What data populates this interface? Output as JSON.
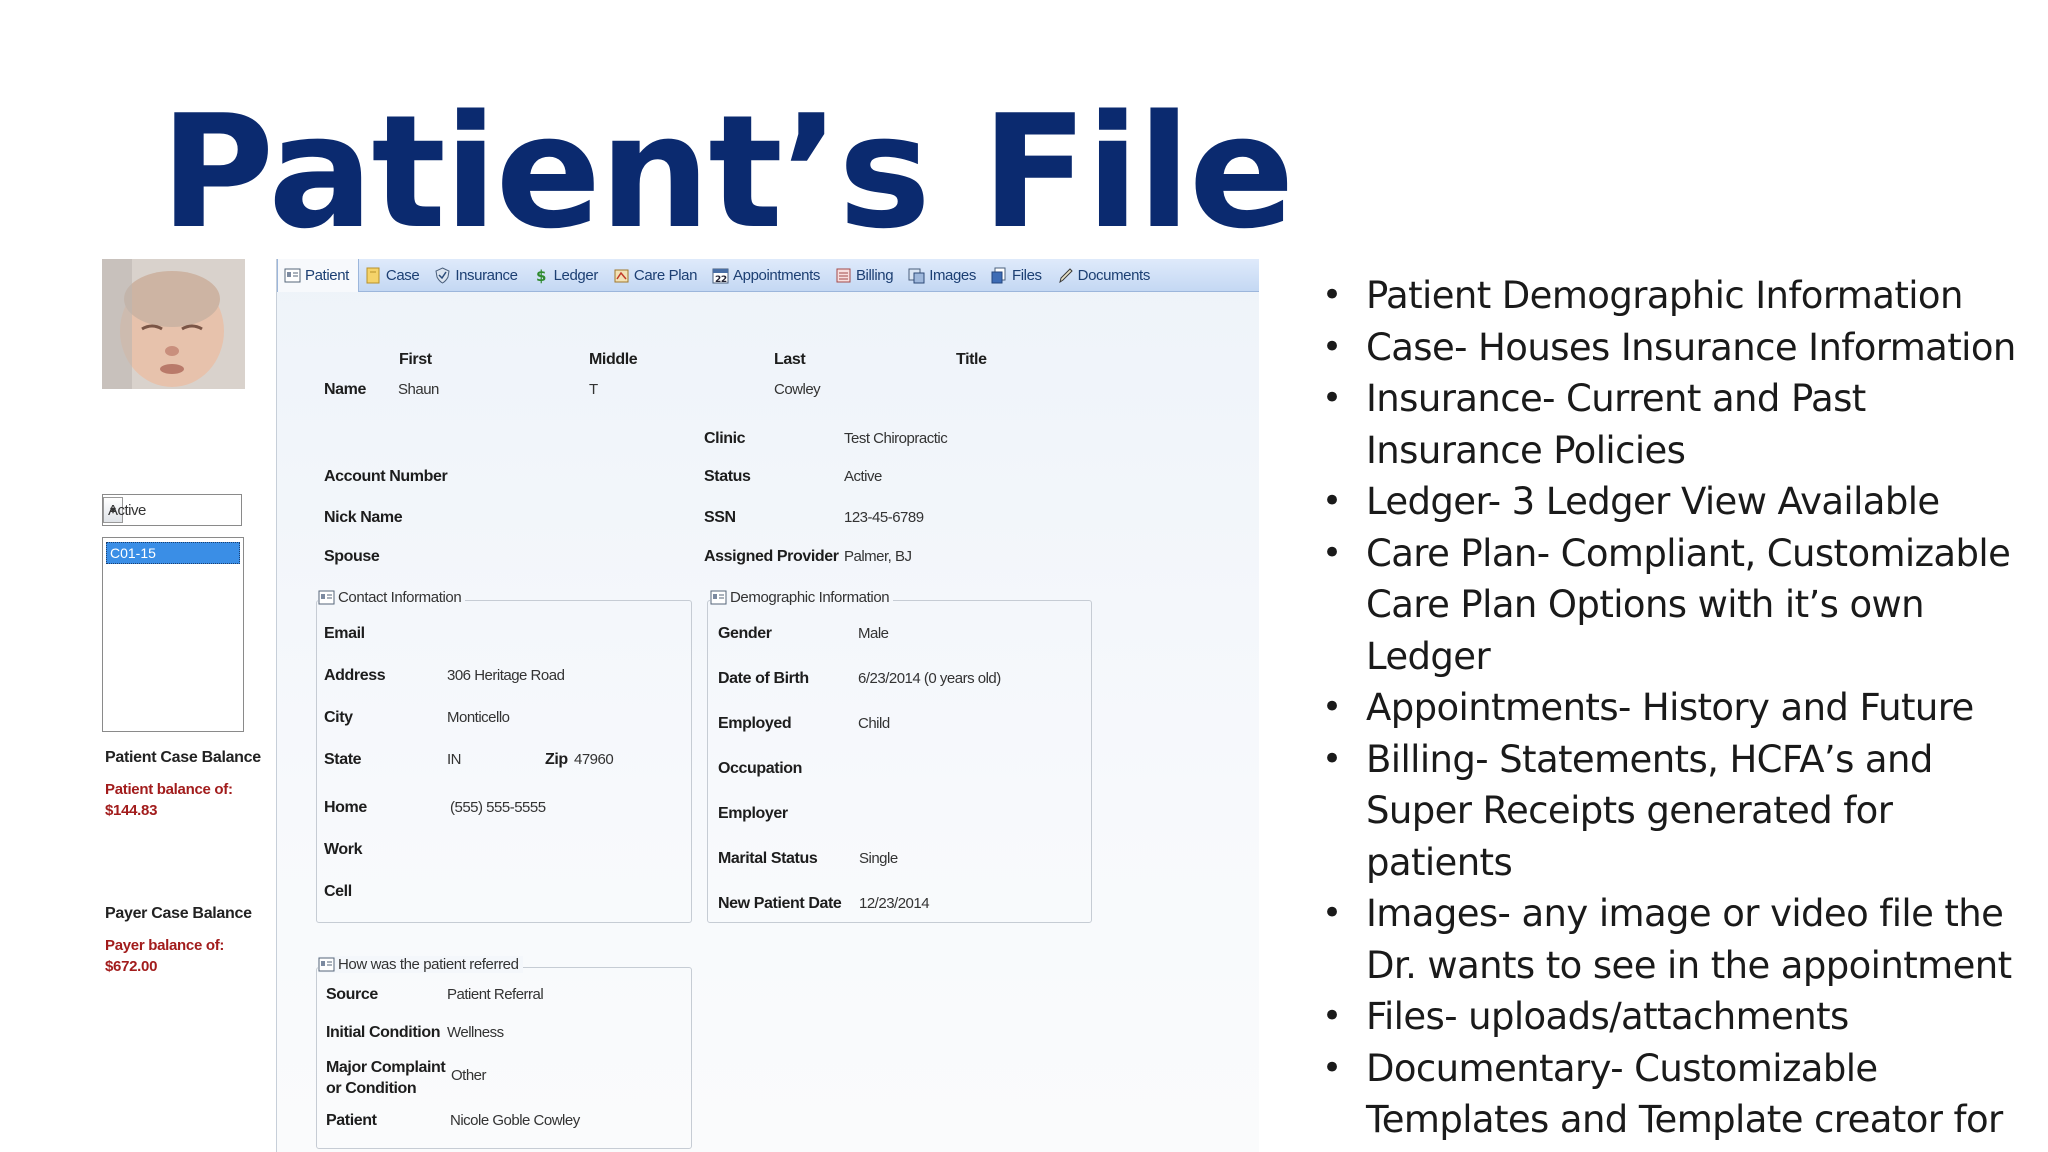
{
  "slide": {
    "title": "Patient’s File"
  },
  "sidebar": {
    "status_value": "Active",
    "cases": [
      "C01-15"
    ],
    "patient_case_balance_label": "Patient Case Balance",
    "patient_balance_line1": "Patient balance of:",
    "patient_balance_amount": "$144.83",
    "payer_case_balance_label": "Payer Case Balance",
    "payer_balance_line1": "Payer balance of:",
    "payer_balance_amount": "$672.00"
  },
  "tabs": [
    {
      "label": "Patient",
      "icon": "patient-card-icon"
    },
    {
      "label": "Case",
      "icon": "folder-icon"
    },
    {
      "label": "Insurance",
      "icon": "shield-icon"
    },
    {
      "label": "Ledger",
      "icon": "dollar-icon"
    },
    {
      "label": "Care Plan",
      "icon": "care-plan-icon"
    },
    {
      "label": "Appointments",
      "icon": "calendar-icon"
    },
    {
      "label": "Billing",
      "icon": "billing-icon"
    },
    {
      "label": "Images",
      "icon": "images-icon"
    },
    {
      "label": "Files",
      "icon": "files-icon"
    },
    {
      "label": "Documents",
      "icon": "pen-icon"
    }
  ],
  "name_section": {
    "first_header": "First",
    "middle_header": "Middle",
    "last_header": "Last",
    "title_header": "Title",
    "name_label": "Name",
    "first": "Shaun",
    "middle": "T",
    "last": "Cowley"
  },
  "account": {
    "account_number_label": "Account Number",
    "nick_name_label": "Nick Name",
    "spouse_label": "Spouse",
    "clinic_label": "Clinic",
    "clinic": "Test Chiropractic",
    "status_label": "Status",
    "status": "Active",
    "ssn_label": "SSN",
    "ssn": "123-45-6789",
    "assigned_provider_label": "Assigned Provider",
    "assigned_provider": "Palmer, BJ"
  },
  "contact": {
    "title": "Contact Information",
    "email_label": "Email",
    "address_label": "Address",
    "address": "306 Heritage Road",
    "city_label": "City",
    "city": "Monticello",
    "state_label": "State",
    "state": "IN",
    "zip_label": "Zip",
    "zip": "47960",
    "home_label": "Home",
    "home": "(555) 555-5555",
    "work_label": "Work",
    "cell_label": "Cell"
  },
  "demographic": {
    "title": "Demographic Information",
    "gender_label": "Gender",
    "gender": "Male",
    "dob_label": "Date of Birth",
    "dob": "6/23/2014 (0 years old)",
    "employed_label": "Employed",
    "employed": "Child",
    "occupation_label": "Occupation",
    "employer_label": "Employer",
    "marital_label": "Marital Status",
    "marital": "Single",
    "new_patient_label": "New Patient Date",
    "new_patient": "12/23/2014"
  },
  "referral": {
    "title": "How was the patient referred",
    "source_label": "Source",
    "source": "Patient Referral",
    "initial_label": "Initial Condition",
    "initial": "Wellness",
    "major_label_1": "Major Complaint",
    "major_label_2": "or Condition",
    "major": "Other",
    "patient_label": "Patient",
    "patient": "Nicole Goble Cowley"
  },
  "bullets": [
    "Patient Demographic Information",
    "Case- Houses Insurance Information",
    "Insurance- Current and Past Insurance Policies",
    "Ledger- 3 Ledger View Available",
    "Care Plan- Compliant, Customizable Care Plan Options with it’s own Ledger",
    "Appointments- History and Future",
    "Billing- Statements, HCFA’s and Super Receipts generated for patients",
    "Images- any image or video file the Dr. wants to see in the appointment",
    "Files- uploads/attachments",
    "Documentary- Customizable Templates and Template creator for letters to patients"
  ]
}
